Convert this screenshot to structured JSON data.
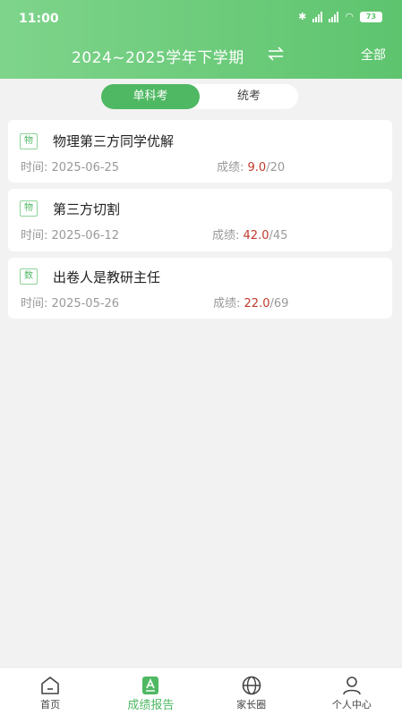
{
  "status": {
    "time": "11:00",
    "battery": "73"
  },
  "header": {
    "term": "2024~2025学年下学期",
    "filter_label": "全部"
  },
  "tabs": [
    {
      "label": "单科考",
      "active": true
    },
    {
      "label": "统考",
      "active": false
    }
  ],
  "exams": [
    {
      "subject_tag": "物",
      "title": "物理第三方同学优解",
      "time_label": "时间:",
      "date": "2025-06-25",
      "score_label": "成绩:",
      "score": "9.0",
      "total": "/20"
    },
    {
      "subject_tag": "物",
      "title": "第三方切割",
      "time_label": "时间:",
      "date": "2025-06-12",
      "score_label": "成绩:",
      "score": "42.0",
      "total": "/45"
    },
    {
      "subject_tag": "数",
      "title": "出卷人是教研主任",
      "time_label": "时间:",
      "date": "2025-05-26",
      "score_label": "成绩:",
      "score": "22.0",
      "total": "/69"
    }
  ],
  "nav": [
    {
      "label": "首页",
      "icon": "home-icon",
      "active": false
    },
    {
      "label": "成绩报告",
      "icon": "report-icon",
      "active": true
    },
    {
      "label": "家长圈",
      "icon": "globe-icon",
      "active": false
    },
    {
      "label": "个人中心",
      "icon": "user-icon",
      "active": false
    }
  ],
  "colors": {
    "accent": "#4fb863",
    "header_start": "#7ed48b",
    "header_end": "#5ec46e",
    "score": "#c0392b"
  }
}
